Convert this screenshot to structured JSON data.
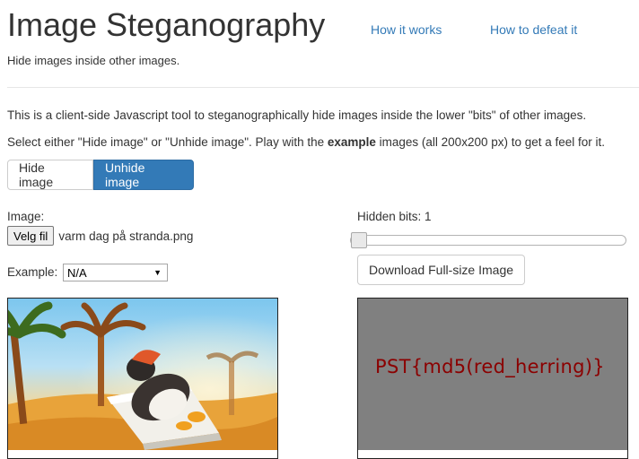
{
  "header": {
    "title": "Image Steganography",
    "nav": [
      "How it works",
      "How to defeat it"
    ],
    "subtitle": "Hide images inside other images."
  },
  "intro": {
    "line1": "This is a client-side Javascript tool to steganographically hide images inside the lower \"bits\" of other images.",
    "line2_before": "Select either \"Hide image\" or \"Unhide image\". Play with the ",
    "line2_bold": "example",
    "line2_after": " images (all 200x200 px) to get a feel for it."
  },
  "mode": {
    "options": [
      "Hide image",
      "Unhide image"
    ],
    "selected": "Unhide image"
  },
  "image_input": {
    "label": "Image:",
    "button": "Velg fil",
    "file_name": "varm dag på stranda.png"
  },
  "example": {
    "label": "Example:",
    "selected": "N/A"
  },
  "hidden_bits": {
    "label": "Hidden bits: 1",
    "value": 1
  },
  "download_button": "Download Full-size Image",
  "output": {
    "revealed_text": "PST{md5(red_herring)}"
  },
  "colors": {
    "accent": "#337ab7",
    "hidden_text": "#8b0000",
    "output_background": "#808080"
  }
}
